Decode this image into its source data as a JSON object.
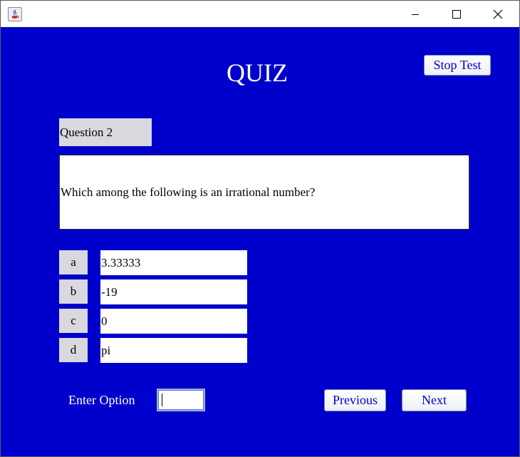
{
  "window": {
    "icons": {
      "app": "java-app-icon",
      "minimize": "minimize-icon",
      "maximize": "maximize-icon",
      "close": "close-icon"
    }
  },
  "quiz": {
    "title": "QUIZ",
    "stop_label": "Stop Test",
    "question_label": "Question 2",
    "question_text": "Which among the following is an irrational number?",
    "options": [
      {
        "key": "a",
        "value": "3.33333"
      },
      {
        "key": "b",
        "value": "-19"
      },
      {
        "key": "c",
        "value": "0"
      },
      {
        "key": "d",
        "value": "pi"
      }
    ],
    "enter_option_label": "Enter Option",
    "enter_option_value": "",
    "previous_label": "Previous",
    "next_label": "Next"
  },
  "colors": {
    "background": "#0000cc",
    "label_gray": "#d8d8de",
    "button_text": "#0000cc"
  }
}
